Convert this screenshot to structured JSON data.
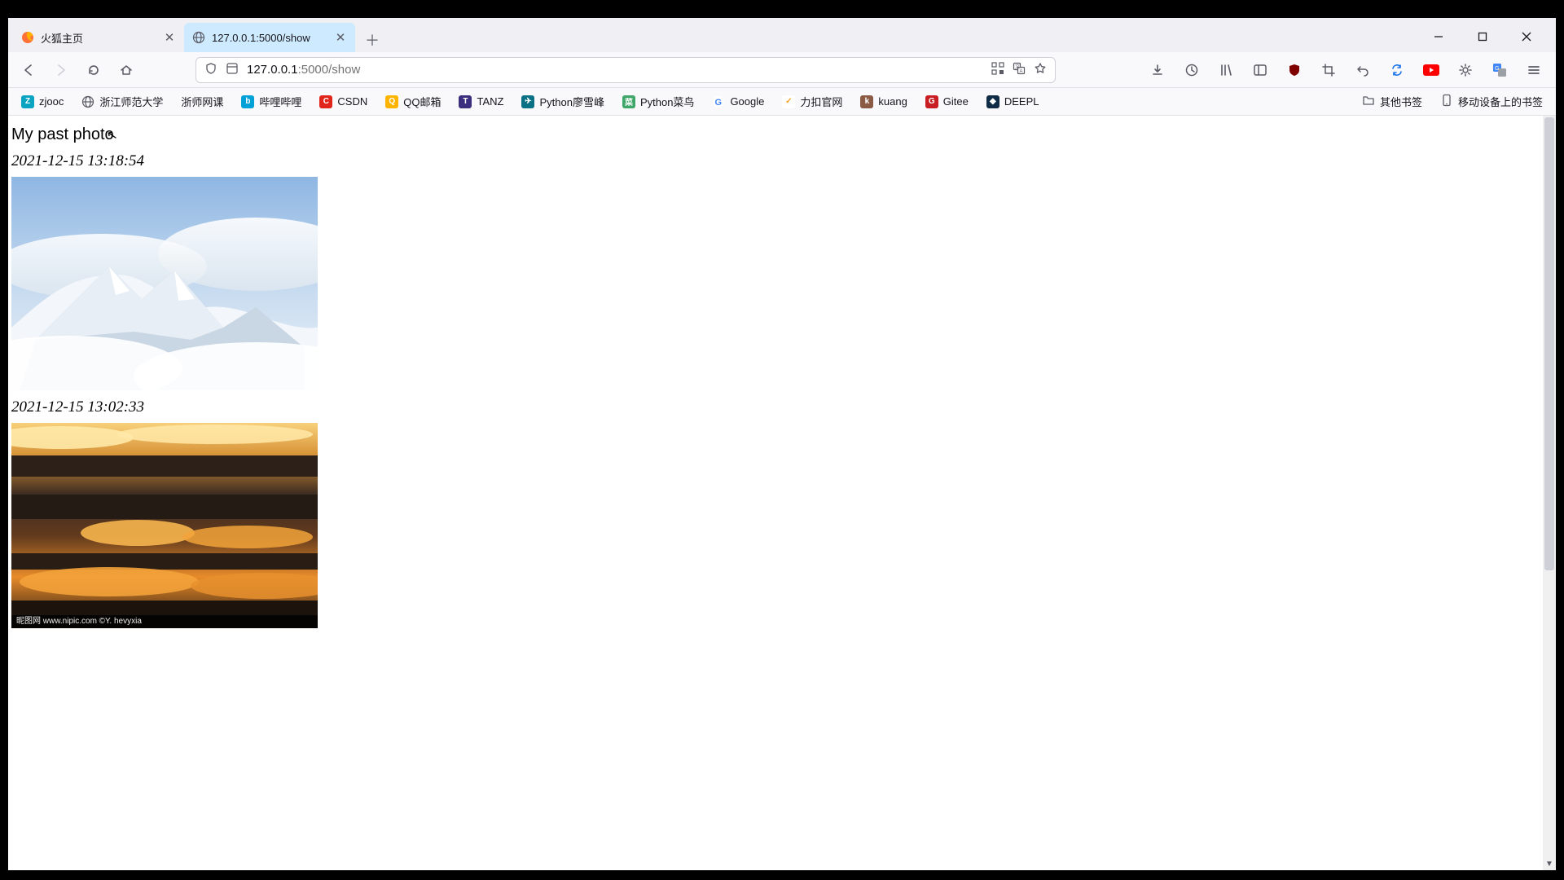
{
  "tabs": {
    "items": [
      {
        "label": "火狐主页",
        "active": false
      },
      {
        "label": "127.0.0.1:5000/show",
        "active": true
      }
    ]
  },
  "url": {
    "host": "127.0.0.1",
    "port_path": ":5000/show"
  },
  "bookmarks": {
    "items": [
      {
        "label": "zjooc",
        "color": "#0aa3c2"
      },
      {
        "label": "浙江师范大学",
        "color": "#8a8a8a",
        "globe": true
      },
      {
        "label": "浙师网课",
        "color": ""
      },
      {
        "label": "哔哩哔哩",
        "color": "#00a1d6"
      },
      {
        "label": "CSDN",
        "color": "#e1251b"
      },
      {
        "label": "QQ邮箱",
        "color": "#ffb400"
      },
      {
        "label": "TANZ",
        "color": "#3b2e7e"
      },
      {
        "label": "Python廖雪峰",
        "color": "#0b7285"
      },
      {
        "label": "Python菜鸟",
        "color": "#3fa66a"
      },
      {
        "label": "Google",
        "color": "",
        "google": true
      },
      {
        "label": "力扣官网",
        "color": "#f89f1b"
      },
      {
        "label": "kuang",
        "color": "#8a5a44"
      },
      {
        "label": "Gitee",
        "color": "#c71d23"
      },
      {
        "label": "DEEPL",
        "color": "#0f2b46"
      }
    ],
    "folder_label": "其他书签",
    "mobile_label": "移动设备上的书签"
  },
  "page": {
    "title": "My past photo",
    "photos": [
      {
        "ts": "2021-12-15 13:18:54",
        "alt": "snowy mountain above clouds"
      },
      {
        "ts": "2021-12-15 13:02:33",
        "alt": "sunset clouds"
      }
    ],
    "sunset_footer_left": "昵图网  www.nipic.com   ©Y. hevyxia",
    "sunset_footer_right": ""
  }
}
